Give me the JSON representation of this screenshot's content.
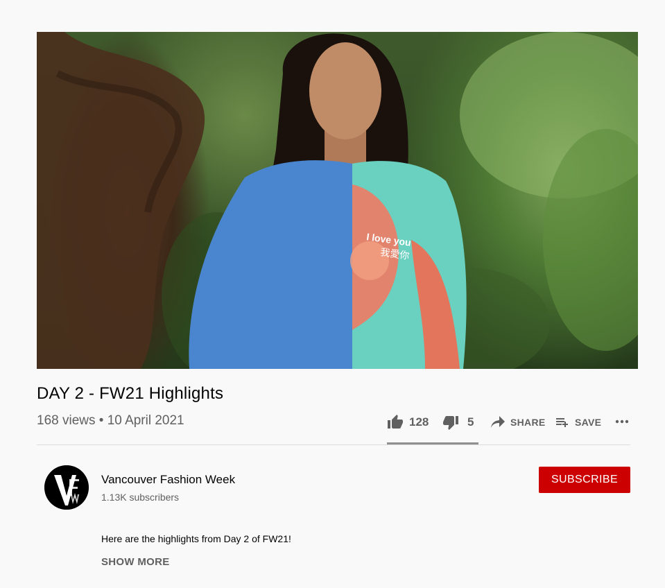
{
  "video": {
    "title": "DAY 2 - FW21 Highlights",
    "meta": "168 views • 10 April 2021",
    "shirt_text_en": "I love you",
    "shirt_text_zh": "我愛你"
  },
  "actions": {
    "likes": "128",
    "dislikes": "5",
    "share_label": "SHARE",
    "save_label": "SAVE",
    "like_ratio": 0.962
  },
  "channel": {
    "name": "Vancouver Fashion Week",
    "subscribers": "1.13K subscribers",
    "logo_text": "VFW",
    "subscribe_label": "SUBSCRIBE"
  },
  "description": {
    "text": "Here are the highlights from Day 2 of FW21!",
    "show_more_label": "SHOW MORE"
  },
  "colors": {
    "subscribe_bg": "#cc0000",
    "secondary_text": "#606060"
  },
  "icons": [
    "thumbs-up-icon",
    "thumbs-down-icon",
    "share-arrow-icon",
    "playlist-add-icon",
    "more-horizontal-icon"
  ]
}
